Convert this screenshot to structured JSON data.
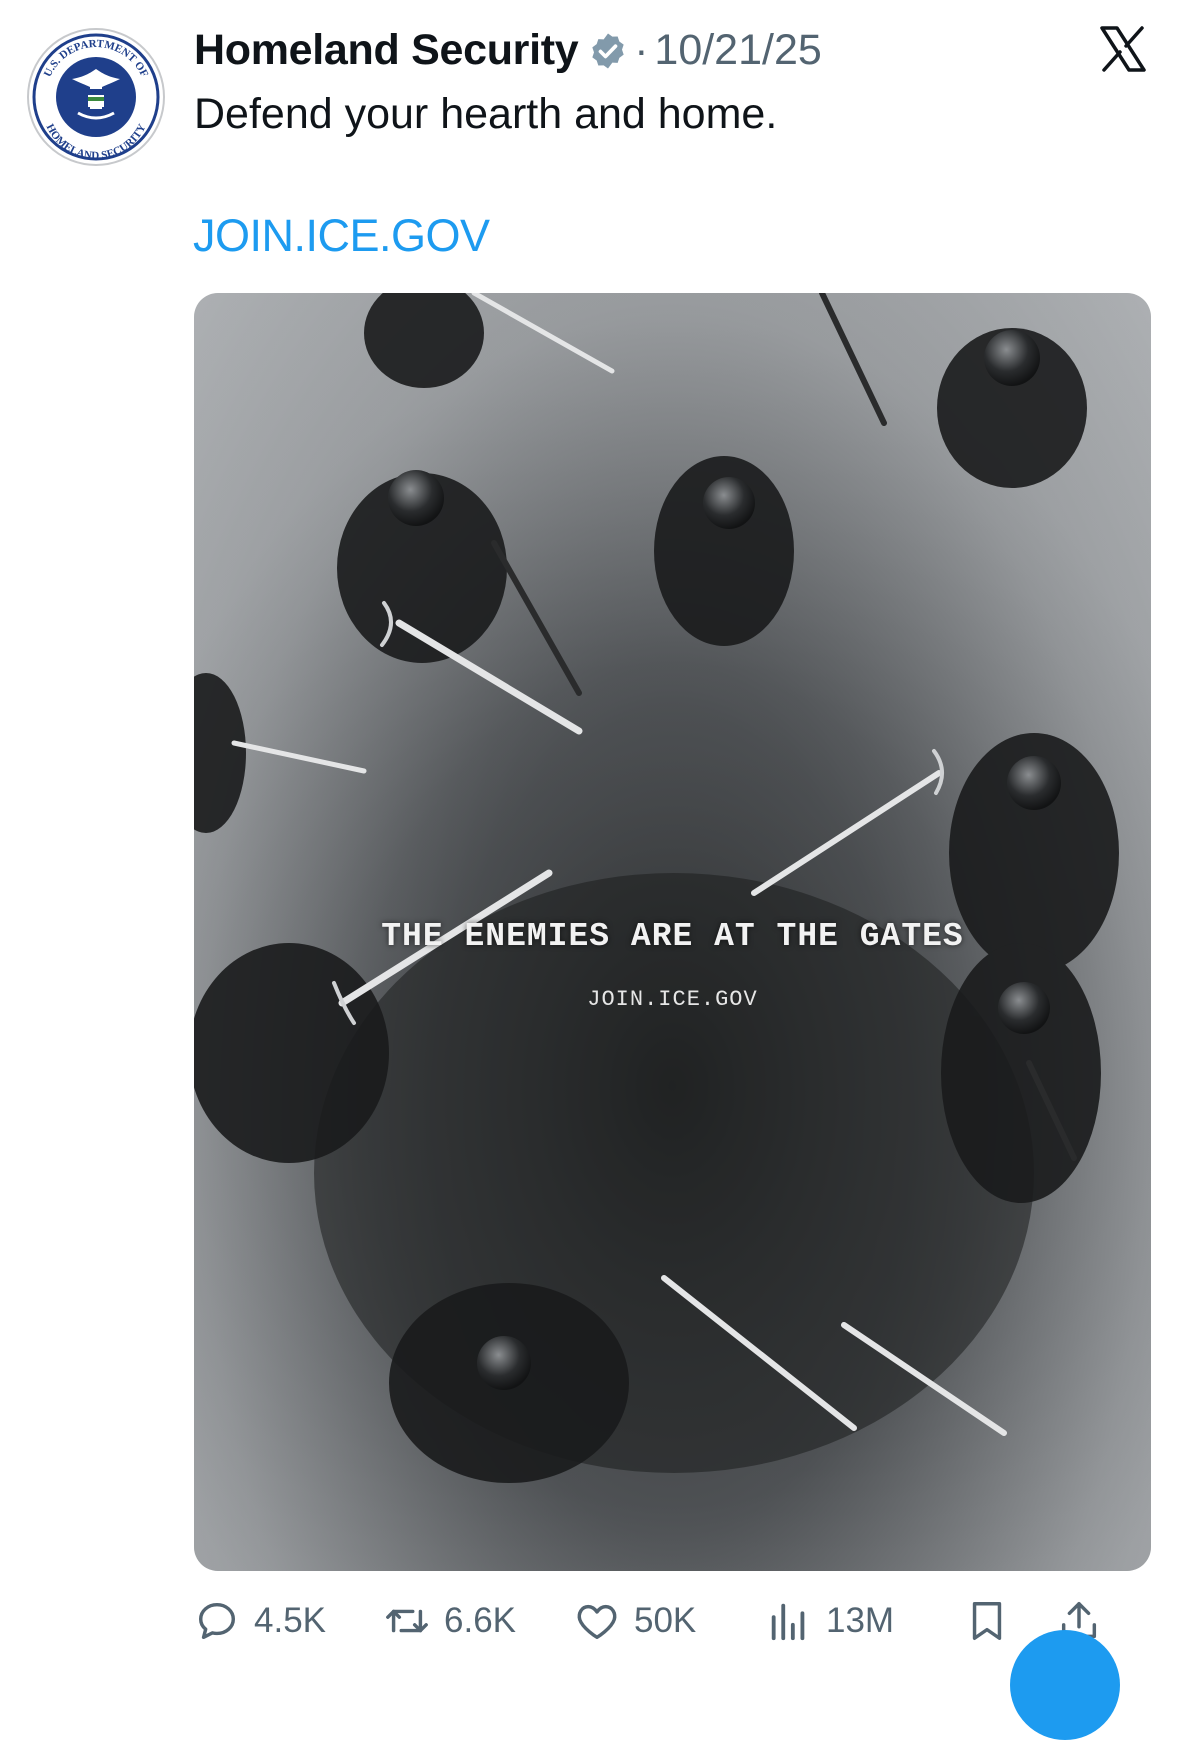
{
  "tweet": {
    "author": "Homeland Security",
    "separator": "·",
    "date": "10/21/25",
    "text": "Defend your hearth and home.",
    "link": "JOIN.ICE.GOV"
  },
  "avatar": {
    "seal_top": "U.S. DEPARTMENT OF",
    "seal_bottom": "HOMELAND SECURITY"
  },
  "media": {
    "headline": "THE ENEMIES ARE AT THE GATES",
    "subline": "JOIN.ICE.GOV"
  },
  "actions": {
    "replies": "4.5K",
    "reposts": "6.6K",
    "likes": "50K",
    "views": "13M"
  },
  "colors": {
    "accent": "#1d9bf0",
    "muted": "#536471",
    "text": "#0f1419"
  },
  "icons": [
    "verified-badge-icon",
    "x-logo-icon",
    "reply-icon",
    "repost-icon",
    "like-icon",
    "views-icon",
    "bookmark-icon",
    "share-icon"
  ]
}
